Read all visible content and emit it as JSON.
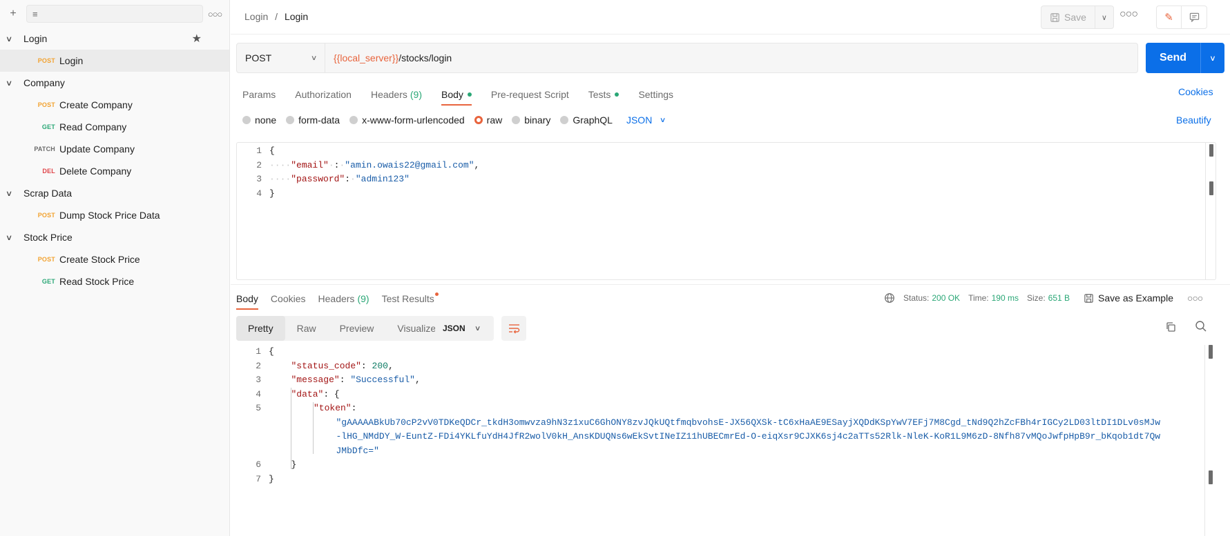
{
  "sidebar": {
    "new_icon": "plus-icon",
    "filter_icon": "filter-icon",
    "more_icon": "more-horizontal-icon",
    "folders": [
      {
        "name": "Login",
        "starred": true,
        "requests": [
          {
            "method": "POST",
            "name": "Login",
            "active": true
          }
        ]
      },
      {
        "name": "Company",
        "requests": [
          {
            "method": "POST",
            "name": "Create Company"
          },
          {
            "method": "GET",
            "name": "Read Company"
          },
          {
            "method": "PATCH",
            "name": "Update Company"
          },
          {
            "method": "DEL",
            "name": "Delete Company"
          }
        ]
      },
      {
        "name": "Scrap Data",
        "requests": [
          {
            "method": "POST",
            "name": "Dump Stock Price Data"
          }
        ]
      },
      {
        "name": "Stock Price",
        "requests": [
          {
            "method": "POST",
            "name": "Create Stock Price"
          },
          {
            "method": "GET",
            "name": "Read Stock Price"
          }
        ]
      }
    ]
  },
  "header": {
    "breadcrumb_parent": "Login",
    "breadcrumb_sep": "/",
    "breadcrumb_current": "Login",
    "save_label": "Save"
  },
  "request": {
    "method": "POST",
    "url_variable": "{{local_server}}",
    "url_path": "/stocks/login",
    "send_label": "Send",
    "tabs": [
      {
        "label": "Params"
      },
      {
        "label": "Authorization"
      },
      {
        "label": "Headers",
        "count": "(9)"
      },
      {
        "label": "Body",
        "dot": true,
        "active": true
      },
      {
        "label": "Pre-request Script"
      },
      {
        "label": "Tests",
        "dot": true
      },
      {
        "label": "Settings"
      }
    ],
    "cookies_label": "Cookies",
    "body_types": [
      {
        "label": "none"
      },
      {
        "label": "form-data"
      },
      {
        "label": "x-www-form-urlencoded"
      },
      {
        "label": "raw",
        "selected": true
      },
      {
        "label": "binary"
      },
      {
        "label": "GraphQL"
      }
    ],
    "body_language": "JSON",
    "beautify_label": "Beautify",
    "body_lines": [
      {
        "num": "1",
        "segs": [
          [
            "p",
            "{"
          ]
        ]
      },
      {
        "num": "2",
        "segs": [
          [
            "w",
            "····"
          ],
          [
            "k",
            "\"email\""
          ],
          [
            "w",
            "·"
          ],
          [
            "p",
            ":"
          ],
          [
            "w",
            "·"
          ],
          [
            "s",
            "\"amin.owais22@gmail.com\""
          ],
          [
            "p",
            ","
          ]
        ]
      },
      {
        "num": "3",
        "segs": [
          [
            "w",
            "····"
          ],
          [
            "k",
            "\"password\""
          ],
          [
            "p",
            ":"
          ],
          [
            "w",
            "·"
          ],
          [
            "s",
            "\"admin123\""
          ]
        ]
      },
      {
        "num": "4",
        "segs": [
          [
            "p",
            "}"
          ]
        ]
      }
    ]
  },
  "response": {
    "tabs": [
      {
        "label": "Body",
        "active": true
      },
      {
        "label": "Cookies"
      },
      {
        "label": "Headers",
        "count": "(9)"
      },
      {
        "label": "Test Results",
        "alert": true
      }
    ],
    "status_label": "Status:",
    "status_value": "200 OK",
    "time_label": "Time:",
    "time_value": "190 ms",
    "size_label": "Size:",
    "size_value": "651 B",
    "save_example_label": "Save as Example",
    "views": [
      {
        "label": "Pretty",
        "active": true
      },
      {
        "label": "Raw"
      },
      {
        "label": "Preview"
      },
      {
        "label": "Visualize"
      }
    ],
    "format": "JSON",
    "body_lines": [
      {
        "num": "1",
        "indent": 0,
        "segs": [
          [
            "p",
            "{"
          ]
        ]
      },
      {
        "num": "2",
        "indent": 1,
        "segs": [
          [
            "k",
            "\"status_code\""
          ],
          [
            "p",
            ": "
          ],
          [
            "n",
            "200"
          ],
          [
            "p",
            ","
          ]
        ]
      },
      {
        "num": "3",
        "indent": 1,
        "segs": [
          [
            "k",
            "\"message\""
          ],
          [
            "p",
            ": "
          ],
          [
            "s",
            "\"Successful\""
          ],
          [
            "p",
            ","
          ]
        ]
      },
      {
        "num": "4",
        "indent": 1,
        "segs": [
          [
            "k",
            "\"data\""
          ],
          [
            "p",
            ": {"
          ]
        ]
      },
      {
        "num": "5",
        "indent": 2,
        "segs": [
          [
            "k",
            "\"token\""
          ],
          [
            "p",
            ":"
          ]
        ]
      },
      {
        "num": "",
        "indent": 3,
        "segs": [
          [
            "s",
            "\"gAAAAABkUb70cP2vV0TDKeQDCr_tkdH3omwvza9hN3z1xuC6GhONY8zvJQkUQtfmqbvohsE-JX56QXSk-tC6xHaAE9ESayjXQDdKSpYwV7EFj7M8Cgd_tNd9Q2hZcFBh4rIGCy2LD03ltDI1DLv0sMJw"
          ]
        ]
      },
      {
        "num": "",
        "indent": 3,
        "segs": [
          [
            "s",
            "-lHG_NMdDY_W-EuntZ-FDi4YKLfuYdH4JfR2wolV0kH_AnsKDUQNs6wEkSvtINeIZ11hUBECmrEd-O-eiqXsr9CJXK6sj4c2aTTs52Rlk-NleK-KoR1L9M6zD-8Nfh87vMQoJwfpHpB9r_bKqob1dt7Qw"
          ]
        ]
      },
      {
        "num": "",
        "indent": 3,
        "segs": [
          [
            "s",
            "JMbDfc=\""
          ]
        ]
      },
      {
        "num": "6",
        "indent": 1,
        "segs": [
          [
            "p",
            "}"
          ]
        ]
      },
      {
        "num": "7",
        "indent": 0,
        "segs": [
          [
            "p",
            "}"
          ]
        ]
      }
    ]
  }
}
